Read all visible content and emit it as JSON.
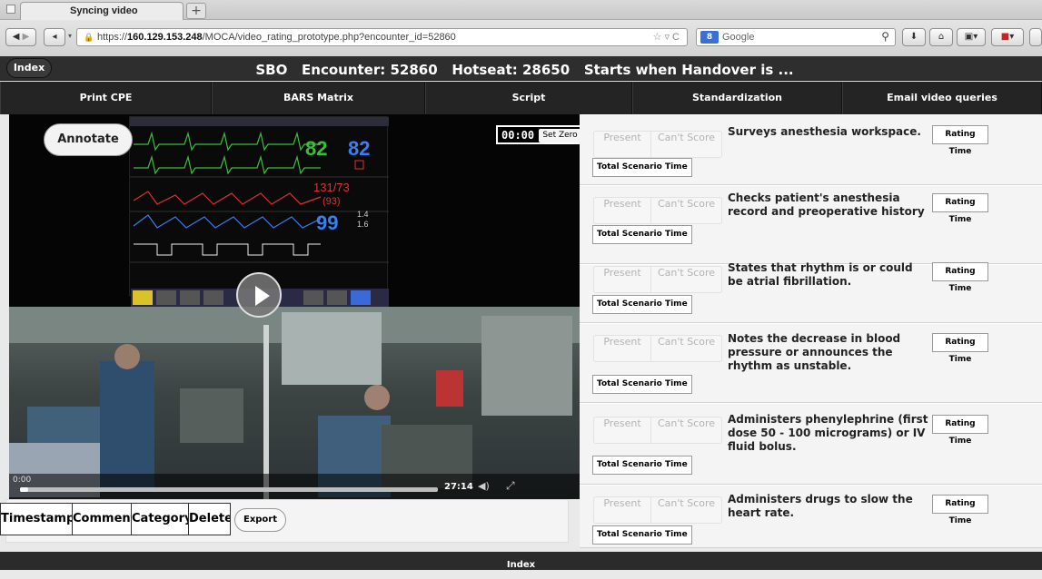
{
  "browser": {
    "tab_title": "Syncing video",
    "new_tab_label": "+",
    "url_prefix": "https://",
    "url_host": "160.129.153.248",
    "url_path": "/MOCA/video_rating_prototype.php?encounter_id=52860",
    "search_placeholder": "Google",
    "search_engine_icon": "g-badge-icon"
  },
  "header": {
    "index_label": "Index",
    "title": "SBO   Encounter: 52860   Hotseat: 28650   Starts when Handover is ..."
  },
  "menu": [
    {
      "label": "Print CPE"
    },
    {
      "label": "BARS Matrix"
    },
    {
      "label": "Script"
    },
    {
      "label": "Standardization"
    },
    {
      "label": "Email video queries"
    }
  ],
  "video": {
    "annotate_label": "Annotate",
    "timer_value": "00:00",
    "set_zero_label": "Set Zero",
    "current_time": "0:00",
    "duration": "27:14",
    "progress_fraction": 0.02
  },
  "monitor_readouts": {
    "hr": "82",
    "hr2": "82",
    "bp": "131/73",
    "map": "(93)",
    "spo2": "99",
    "mac1": "1.4",
    "mac2": "1.6"
  },
  "annotations": {
    "headers": [
      "Timestamp",
      "Comment",
      "Category",
      "Delete"
    ],
    "export_label": "Export"
  },
  "ratings": {
    "present_label": "Present",
    "cant_score_label": "Can't Score",
    "total_time_label": "Total Scenario Time",
    "rating_time_label": "Rating Time",
    "items": [
      {
        "text": "Surveys anesthesia workspace."
      },
      {
        "text": "Checks patient's anesthesia record and preoperative history"
      },
      {
        "text": "States that rhythm is or could be atrial fibrillation."
      },
      {
        "text": "Notes the decrease in blood pressure or announces the rhythm as unstable."
      },
      {
        "text": "Administers phenylephrine (first dose 50 - 100 micrograms) or IV fluid bolus."
      },
      {
        "text": "Administers drugs to slow the heart rate."
      }
    ]
  },
  "footer": {
    "label": "Index"
  },
  "colors": {
    "header_bg": "#2e2e2e",
    "menu_bg": "#242424",
    "monitor_green": "#3bbf3b",
    "monitor_blue": "#3a7ff0",
    "monitor_red": "#d33"
  }
}
